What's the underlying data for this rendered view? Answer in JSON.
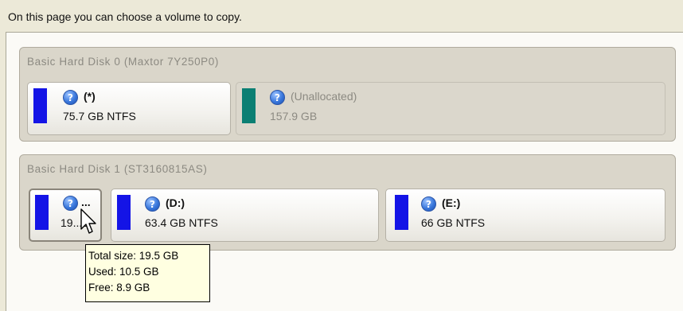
{
  "instruction": "On this page you can choose a volume to copy.",
  "disks": [
    {
      "title": "Basic Hard Disk 0 (Maxtor 7Y250P0)",
      "volumes": [
        {
          "label": "(*)",
          "size": "75.7 GB NTFS",
          "color": "#1414e6",
          "type": "partition"
        },
        {
          "label": "(Unallocated)",
          "size": "157.9 GB",
          "color": "#0b7f73",
          "type": "unallocated"
        }
      ]
    },
    {
      "title": "Basic Hard Disk 1 (ST3160815AS)",
      "volumes": [
        {
          "label": "...",
          "size": "19...5",
          "color": "#1414e6",
          "type": "partition",
          "state": "selected"
        },
        {
          "label": "(D:)",
          "size": "63.4 GB NTFS",
          "color": "#1414e6",
          "type": "partition"
        },
        {
          "label": "(E:)",
          "size": "66 GB NTFS",
          "color": "#1414e6",
          "type": "partition"
        }
      ]
    }
  ],
  "tooltip": {
    "total": "Total size: 19.5 GB",
    "used": "Used: 10.5 GB",
    "free": "Free: 8.9 GB"
  },
  "icons": {
    "volume_help": "question-icon",
    "pointer": "mouse-cursor-icon"
  }
}
